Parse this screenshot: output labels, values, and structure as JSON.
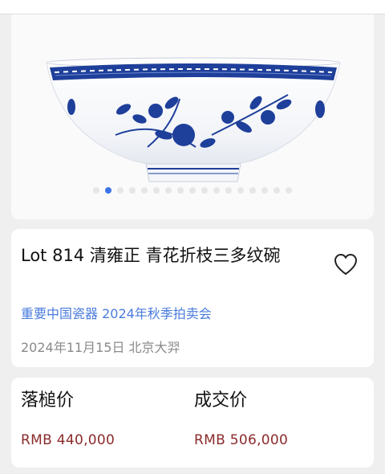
{
  "lot": {
    "title": "Lot 814 清雍正 青花折枝三多纹碗",
    "sale_name": "重要中国瓷器 2024年秋季拍卖会",
    "date_location": "2024年11月15日 北京大羿"
  },
  "carousel": {
    "active_index": 1,
    "dot_count": 17
  },
  "prices": {
    "hammer_label": "落槌价",
    "hammer_value": "RMB 440,000",
    "final_label": "成交价",
    "final_value": "RMB 506,000"
  },
  "colors": {
    "accent_blue": "#3b74e6",
    "link_blue": "#4a7bdc",
    "price_red": "#8b2b2b",
    "porcelain_blue": "#1e3f9a"
  },
  "icons": {
    "favorite": "heart-outline-icon"
  }
}
